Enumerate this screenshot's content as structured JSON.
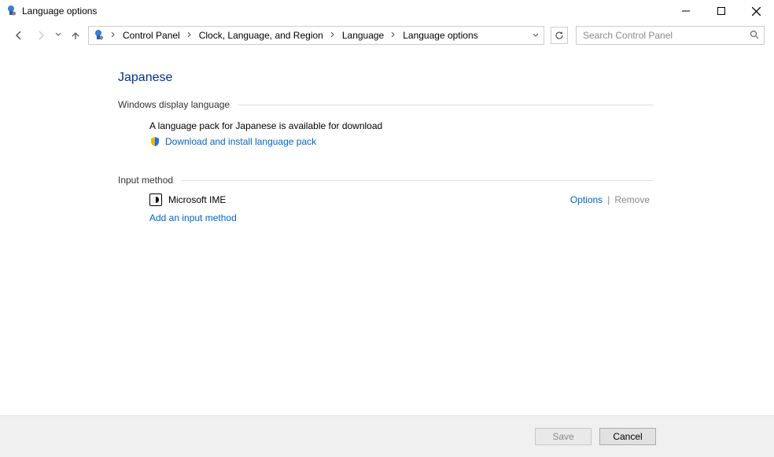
{
  "window": {
    "title": "Language options"
  },
  "breadcrumb": {
    "items": [
      "Control Panel",
      "Clock, Language, and Region",
      "Language",
      "Language options"
    ]
  },
  "search": {
    "placeholder": "Search Control Panel"
  },
  "page": {
    "language_heading": "Japanese",
    "display_section_label": "Windows display language",
    "pack_available_text": "A language pack for Japanese is available for download",
    "download_link": "Download and install language pack",
    "input_section_label": "Input method",
    "ime_name": "Microsoft IME",
    "options_link": "Options",
    "remove_link": "Remove",
    "add_input_link": "Add an input method"
  },
  "footer": {
    "save": "Save",
    "cancel": "Cancel"
  }
}
